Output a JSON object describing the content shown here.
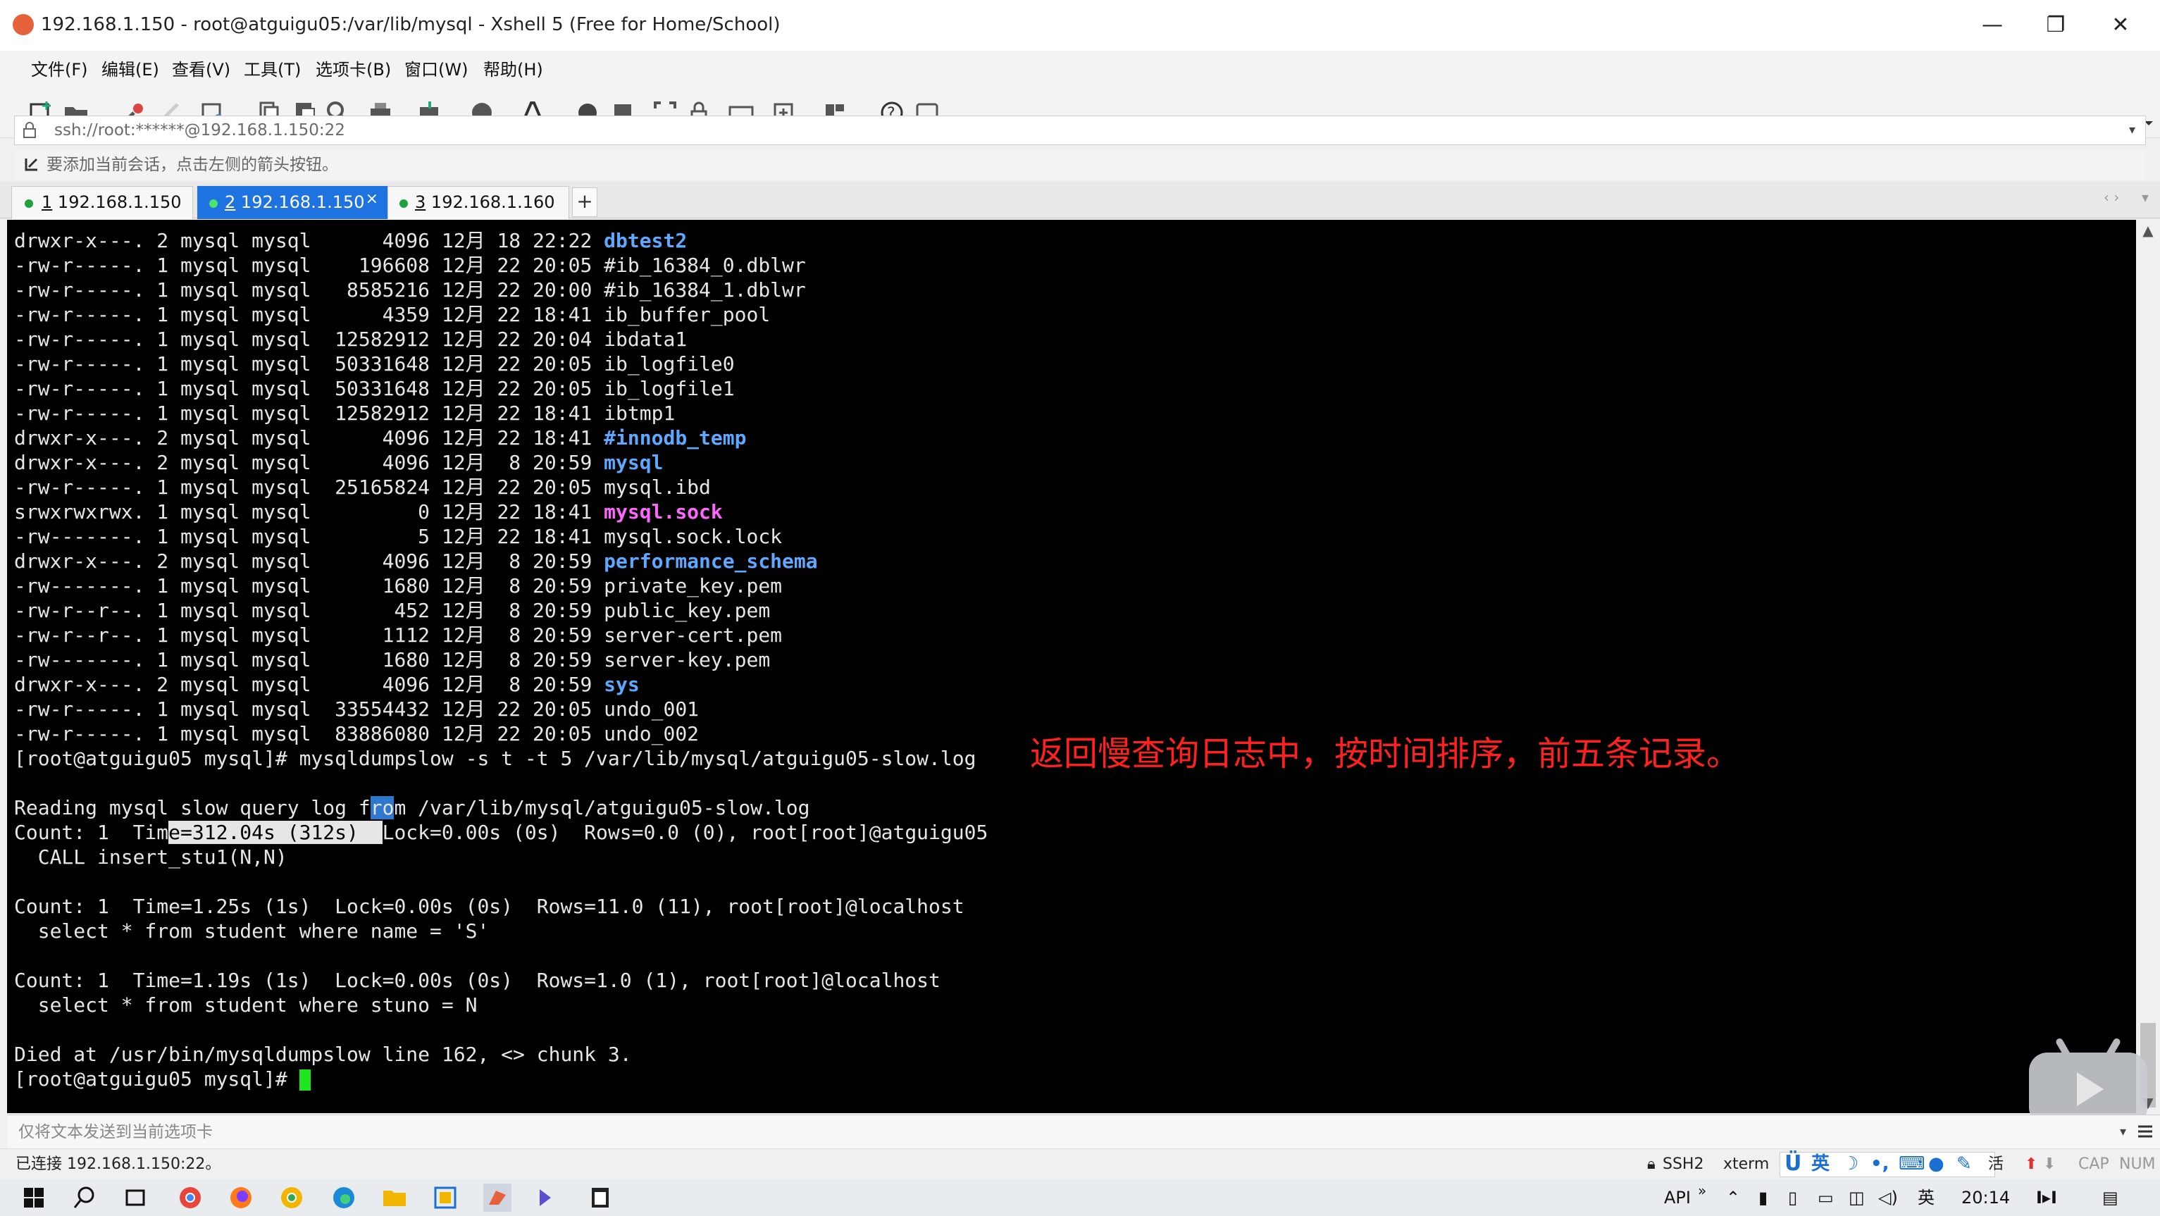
{
  "window": {
    "title": "192.168.1.150 - root@atguigu05:/var/lib/mysql - Xshell 5 (Free for Home/School)",
    "controls": [
      "—",
      "❐",
      "✕"
    ]
  },
  "menu": [
    "文件(F)",
    "编辑(E)",
    "查看(V)",
    "工具(T)",
    "选项卡(B)",
    "窗口(W)",
    "帮助(H)"
  ],
  "address": {
    "value": "ssh://root:******@192.168.1.150:22",
    "dropdown": "▾"
  },
  "hint": "要添加当前会话，点击左侧的箭头按钮。",
  "tabs": [
    {
      "num": "1",
      "host": "192.168.1.150",
      "active": false
    },
    {
      "num": "2",
      "host": "192.168.1.150",
      "active": true
    },
    {
      "num": "3",
      "host": "192.168.1.160",
      "active": false
    }
  ],
  "tab_add": "+",
  "tab_close": "×",
  "terminal": {
    "listing": [
      {
        "meta": "drwxr-x---. 2 mysql mysql      4096 12月 18 22:22 ",
        "name": "dbtest2",
        "kind": "dir"
      },
      {
        "meta": "-rw-r-----. 1 mysql mysql    196608 12月 22 20:05 ",
        "name": "#ib_16384_0.dblwr",
        "kind": "file"
      },
      {
        "meta": "-rw-r-----. 1 mysql mysql   8585216 12月 22 20:00 ",
        "name": "#ib_16384_1.dblwr",
        "kind": "file"
      },
      {
        "meta": "-rw-r-----. 1 mysql mysql      4359 12月 22 18:41 ",
        "name": "ib_buffer_pool",
        "kind": "file"
      },
      {
        "meta": "-rw-r-----. 1 mysql mysql  12582912 12月 22 20:04 ",
        "name": "ibdata1",
        "kind": "file"
      },
      {
        "meta": "-rw-r-----. 1 mysql mysql  50331648 12月 22 20:05 ",
        "name": "ib_logfile0",
        "kind": "file"
      },
      {
        "meta": "-rw-r-----. 1 mysql mysql  50331648 12月 22 20:05 ",
        "name": "ib_logfile1",
        "kind": "file"
      },
      {
        "meta": "-rw-r-----. 1 mysql mysql  12582912 12月 22 18:41 ",
        "name": "ibtmp1",
        "kind": "file"
      },
      {
        "meta": "drwxr-x---. 2 mysql mysql      4096 12月 22 18:41 ",
        "name": "#innodb_temp",
        "kind": "dir"
      },
      {
        "meta": "drwxr-x---. 2 mysql mysql      4096 12月  8 20:59 ",
        "name": "mysql",
        "kind": "dir"
      },
      {
        "meta": "-rw-r-----. 1 mysql mysql  25165824 12月 22 20:05 ",
        "name": "mysql.ibd",
        "kind": "file"
      },
      {
        "meta": "srwxrwxrwx. 1 mysql mysql         0 12月 22 18:41 ",
        "name": "mysql.sock",
        "kind": "sock"
      },
      {
        "meta": "-rw-------. 1 mysql mysql         5 12月 22 18:41 ",
        "name": "mysql.sock.lock",
        "kind": "file"
      },
      {
        "meta": "drwxr-x---. 2 mysql mysql      4096 12月  8 20:59 ",
        "name": "performance_schema",
        "kind": "dir"
      },
      {
        "meta": "-rw-------. 1 mysql mysql      1680 12月  8 20:59 ",
        "name": "private_key.pem",
        "kind": "file"
      },
      {
        "meta": "-rw-r--r--. 1 mysql mysql       452 12月  8 20:59 ",
        "name": "public_key.pem",
        "kind": "file"
      },
      {
        "meta": "-rw-r--r--. 1 mysql mysql      1112 12月  8 20:59 ",
        "name": "server-cert.pem",
        "kind": "file"
      },
      {
        "meta": "-rw-------. 1 mysql mysql      1680 12月  8 20:59 ",
        "name": "server-key.pem",
        "kind": "file"
      },
      {
        "meta": "drwxr-x---. 2 mysql mysql      4096 12月  8 20:59 ",
        "name": "sys",
        "kind": "dir"
      },
      {
        "meta": "-rw-r-----. 1 mysql mysql  33554432 12月 22 20:05 ",
        "name": "undo_001",
        "kind": "file"
      },
      {
        "meta": "-rw-r-----. 1 mysql mysql  83886080 12月 22 20:05 ",
        "name": "undo_002",
        "kind": "file"
      }
    ],
    "command": "[root@atguigu05 mysql]# mysqldumpslow -s t -t 5 /var/lib/mysql/atguigu05-slow.log",
    "reading_a": "Reading mysql slow query log f",
    "reading_b": "ro",
    "reading_c": "m /var/lib/mysql/atguigu05-slow.log",
    "count1_a": "Count: 1  Tim",
    "count1_b": "e=312.04s (312s)  ",
    "count1_c": "Lock=0.00s (0s)  Rows=0.0 (0), root[root]@atguigu05",
    "call1": "  CALL insert_stu1(N,N)",
    "count2": "Count: 1  Time=1.25s (1s)  Lock=0.00s (0s)  Rows=11.0 (11), root[root]@localhost",
    "select2": "  select * from student where name = 'S'",
    "count3": "Count: 1  Time=1.19s (1s)  Lock=0.00s (0s)  Rows=1.0 (1), root[root]@localhost",
    "select3": "  select * from student where stuno = N",
    "died": "Died at /usr/bin/mysqldumpslow line 162, <> chunk 3.",
    "prompt": "[root@atguigu05 mysql]# "
  },
  "annotation": "返回慢查询日志中，按时间排序，前五条记录。",
  "send_bar": "仅将文本发送到当前选项卡",
  "status": {
    "connected": "已连接 192.168.1.150:22。",
    "protocol": "SSH2",
    "terminal": "xterm",
    "ime_lang": "英",
    "ime_mode": "活",
    "cap": "CAP",
    "num": "NUM"
  },
  "taskbar": {
    "api": "API",
    "more": "»",
    "lang": "英",
    "time": "20:14"
  },
  "colors": {
    "terminal_bg": "#000000",
    "terminal_fg": "#e6e6e6",
    "dir": "#5fa8ff",
    "socket": "#ff66ff",
    "cursor": "#1ee61e",
    "annotation": "#ff2020",
    "active_tab": "#1f73e0"
  }
}
